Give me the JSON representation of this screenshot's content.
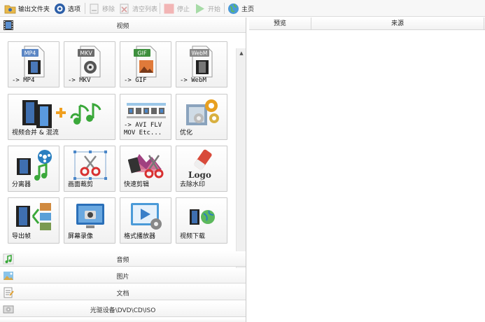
{
  "toolbar": {
    "output_folder": "输出文件夹",
    "options": "选项",
    "remove": "移除",
    "clear_list": "清空列表",
    "stop": "停止",
    "start": "开始",
    "home": "主页"
  },
  "categories": {
    "video": "视频",
    "audio": "音频",
    "image": "图片",
    "document": "文档",
    "disc": "光驱设备\\DVD\\CD\\ISO"
  },
  "tiles": {
    "mp4": {
      "badge": "MP4",
      "label": "-> MP4"
    },
    "mkv": {
      "badge": "MKV",
      "label": "-> MKV"
    },
    "gif": {
      "badge": "GIF",
      "label": "-> GIF"
    },
    "webm": {
      "badge": "WebM",
      "label": "-> WebM"
    },
    "merge": {
      "label": "视频合并 & 混流"
    },
    "avi": {
      "label": "-> AVI FLV\nMOV Etc..."
    },
    "optimize": {
      "label": "优化"
    },
    "splitter": {
      "label": "分离器"
    },
    "crop": {
      "label": "画面裁剪"
    },
    "quick_cut": {
      "label": "快速剪辑"
    },
    "watermark": {
      "label": "去除水印",
      "logo_text": "Logo"
    },
    "export_frames": {
      "label": "导出帧"
    },
    "screen_record": {
      "label": "屏幕录像"
    },
    "player": {
      "label": "格式播放器"
    },
    "download": {
      "label": "视频下载"
    }
  },
  "list": {
    "columns": [
      "预览",
      "来源"
    ]
  },
  "colors": {
    "badge_mp4": "#5b86c4",
    "badge_mkv": "#6b6b6b",
    "badge_gif": "#3d8f3d",
    "badge_webm": "#8a8a8a",
    "accent_green": "#3aa83a"
  }
}
